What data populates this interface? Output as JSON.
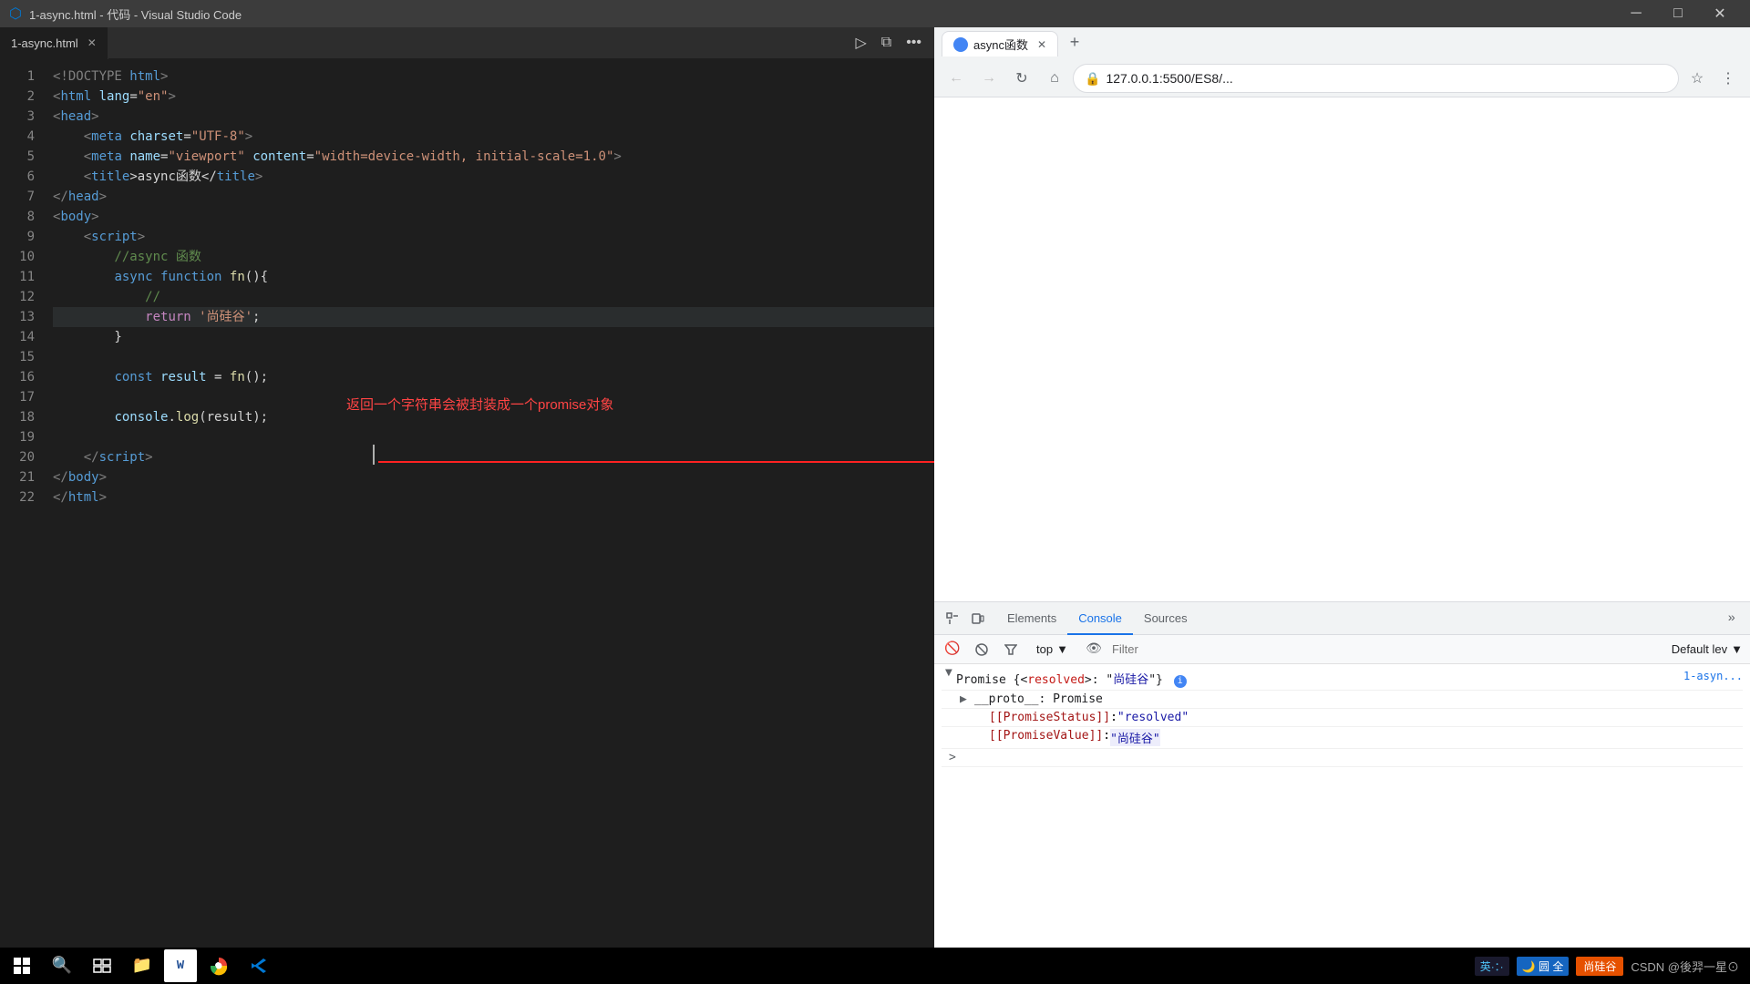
{
  "titleBar": {
    "title": "1-async.html - 代码 - Visual Studio Code",
    "minimize": "─",
    "maximize": "□",
    "close": "✕"
  },
  "editor": {
    "tab": {
      "filename": "1-async.html",
      "close": "✕"
    },
    "lines": [
      {
        "num": 1,
        "tokens": [
          {
            "text": "<!DOCTYPE ",
            "class": "hl-gray"
          },
          {
            "text": "html",
            "class": "hl-blue"
          },
          {
            "text": ">",
            "class": "hl-gray"
          }
        ]
      },
      {
        "num": 2,
        "tokens": [
          {
            "text": "<",
            "class": "hl-gray"
          },
          {
            "text": "html",
            "class": "hl-blue"
          },
          {
            "text": " ",
            "class": ""
          },
          {
            "text": "lang",
            "class": "hl-light-blue"
          },
          {
            "text": "=",
            "class": "hl-white"
          },
          {
            "text": "\"en\"",
            "class": "hl-orange"
          },
          {
            "text": ">",
            "class": "hl-gray"
          }
        ]
      },
      {
        "num": 3,
        "tokens": [
          {
            "text": "<",
            "class": "hl-gray"
          },
          {
            "text": "head",
            "class": "hl-blue"
          },
          {
            "text": ">",
            "class": "hl-gray"
          }
        ]
      },
      {
        "num": 4,
        "tokens": [
          {
            "text": "    <",
            "class": "hl-gray"
          },
          {
            "text": "meta",
            "class": "hl-blue"
          },
          {
            "text": " ",
            "class": ""
          },
          {
            "text": "charset",
            "class": "hl-light-blue"
          },
          {
            "text": "=",
            "class": "hl-white"
          },
          {
            "text": "\"UTF-8\"",
            "class": "hl-orange"
          },
          {
            "text": ">",
            "class": "hl-gray"
          }
        ]
      },
      {
        "num": 5,
        "tokens": [
          {
            "text": "    <",
            "class": "hl-gray"
          },
          {
            "text": "meta",
            "class": "hl-blue"
          },
          {
            "text": " ",
            "class": ""
          },
          {
            "text": "name",
            "class": "hl-light-blue"
          },
          {
            "text": "=",
            "class": "hl-white"
          },
          {
            "text": "\"viewport\"",
            "class": "hl-orange"
          },
          {
            "text": " ",
            "class": ""
          },
          {
            "text": "content",
            "class": "hl-light-blue"
          },
          {
            "text": "=",
            "class": "hl-white"
          },
          {
            "text": "\"width=device-width, initial-scale=1.0\"",
            "class": "hl-orange"
          },
          {
            "text": ">",
            "class": "hl-gray"
          }
        ]
      },
      {
        "num": 6,
        "tokens": [
          {
            "text": "    <",
            "class": "hl-gray"
          },
          {
            "text": "title",
            "class": "hl-blue"
          },
          {
            "text": ">async函数</",
            "class": "hl-white"
          },
          {
            "text": "title",
            "class": "hl-blue"
          },
          {
            "text": ">",
            "class": "hl-gray"
          }
        ]
      },
      {
        "num": 7,
        "tokens": [
          {
            "text": "</",
            "class": "hl-gray"
          },
          {
            "text": "head",
            "class": "hl-blue"
          },
          {
            "text": ">",
            "class": "hl-gray"
          }
        ]
      },
      {
        "num": 8,
        "tokens": [
          {
            "text": "<",
            "class": "hl-gray"
          },
          {
            "text": "body",
            "class": "hl-blue"
          },
          {
            "text": ">",
            "class": "hl-gray"
          }
        ]
      },
      {
        "num": 9,
        "tokens": [
          {
            "text": "    <",
            "class": "hl-gray"
          },
          {
            "text": "script",
            "class": "hl-blue"
          },
          {
            "text": ">",
            "class": "hl-gray"
          }
        ]
      },
      {
        "num": 10,
        "tokens": [
          {
            "text": "        //async 函数",
            "class": "hl-green"
          }
        ]
      },
      {
        "num": 11,
        "tokens": [
          {
            "text": "        ",
            "class": ""
          },
          {
            "text": "async",
            "class": "hl-blue"
          },
          {
            "text": " ",
            "class": ""
          },
          {
            "text": "function",
            "class": "hl-blue"
          },
          {
            "text": " ",
            "class": ""
          },
          {
            "text": "fn",
            "class": "hl-yellow"
          },
          {
            "text": "(){",
            "class": "hl-white"
          }
        ]
      },
      {
        "num": 12,
        "tokens": [
          {
            "text": "            //",
            "class": "hl-green"
          }
        ]
      },
      {
        "num": 13,
        "tokens": [
          {
            "text": "            ",
            "class": ""
          },
          {
            "text": "return",
            "class": "hl-purple"
          },
          {
            "text": " ",
            "class": ""
          },
          {
            "text": "'尚硅谷'",
            "class": "hl-orange"
          },
          {
            "text": ";",
            "class": "hl-white"
          }
        ],
        "highlighted": true
      },
      {
        "num": 14,
        "tokens": [
          {
            "text": "        }",
            "class": "hl-white"
          }
        ]
      },
      {
        "num": 15,
        "tokens": []
      },
      {
        "num": 16,
        "tokens": [
          {
            "text": "        ",
            "class": ""
          },
          {
            "text": "const",
            "class": "hl-blue"
          },
          {
            "text": " ",
            "class": ""
          },
          {
            "text": "result",
            "class": "hl-light-blue"
          },
          {
            "text": " = ",
            "class": "hl-white"
          },
          {
            "text": "fn",
            "class": "hl-yellow"
          },
          {
            "text": "();",
            "class": "hl-white"
          }
        ]
      },
      {
        "num": 17,
        "tokens": []
      },
      {
        "num": 18,
        "tokens": [
          {
            "text": "        ",
            "class": ""
          },
          {
            "text": "console",
            "class": "hl-light-blue"
          },
          {
            "text": ".",
            "class": "hl-white"
          },
          {
            "text": "log",
            "class": "hl-yellow"
          },
          {
            "text": "(result);",
            "class": "hl-white"
          }
        ]
      },
      {
        "num": 19,
        "tokens": []
      },
      {
        "num": 20,
        "tokens": [
          {
            "text": "    </",
            "class": "hl-gray"
          },
          {
            "text": "script",
            "class": "hl-blue"
          },
          {
            "text": ">",
            "class": "hl-gray"
          }
        ]
      },
      {
        "num": 21,
        "tokens": [
          {
            "text": "</",
            "class": "hl-gray"
          },
          {
            "text": "body",
            "class": "hl-blue"
          },
          {
            "text": ">",
            "class": "hl-gray"
          }
        ]
      },
      {
        "num": 22,
        "tokens": [
          {
            "text": "</",
            "class": "hl-gray"
          },
          {
            "text": "html",
            "class": "hl-blue"
          },
          {
            "text": ">",
            "class": "hl-gray"
          }
        ]
      }
    ],
    "annotation": {
      "text": "返回一个字符串会被封装成一个promise对象",
      "color": "#ff4444"
    }
  },
  "browser": {
    "tab": {
      "title": "async函数",
      "close": "✕"
    },
    "newTab": "+",
    "nav": {
      "back": "←",
      "forward": "→",
      "reload": "↻",
      "home": "⌂",
      "url": "127.0.0.1:5500/ES8/...",
      "bookmark": "☆",
      "menu": "⋮"
    },
    "devtools": {
      "tabs": [
        "Elements",
        "Console",
        "Sources",
        "»"
      ],
      "activeTab": "Console",
      "toolbar": {
        "ban": "🚫",
        "clear": "⊘",
        "context": "top",
        "filterPlaceholder": "Filter",
        "defaultLevels": "Default lev"
      },
      "consoleItems": [
        {
          "expanded": true,
          "text": "▶ Promise {<resolved>: \"尚硅谷\"}",
          "source": "1-asyn..."
        },
        {
          "indent": true,
          "text": "▶ __proto__: Promise"
        },
        {
          "indent": true,
          "key": "[[PromiseStatus]]",
          "value": "\"resolved\""
        },
        {
          "indent": true,
          "key": "[[PromiseValue]]",
          "value": "\"尚硅谷\""
        }
      ],
      "chevron": ">"
    }
  },
  "taskbar": {
    "start": "⊞",
    "buttons": [
      "⧉",
      "📁",
      "W",
      "🌐",
      "⬦"
    ],
    "ime1": "英·：·",
    "ime2": "🌙 圆 全",
    "brand": "尚硅谷",
    "csdn": "CSDN @後羿一星⊙"
  }
}
